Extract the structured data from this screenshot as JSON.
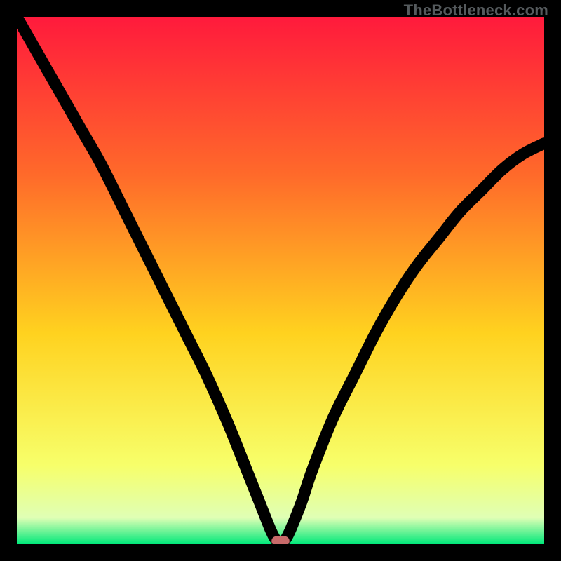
{
  "watermark": "TheBottleneck.com",
  "colors": {
    "gradient_stops": [
      "#ff1a3c",
      "#ff6a2a",
      "#ffd21f",
      "#f7ff6a",
      "#dfffb5",
      "#00e87a"
    ],
    "curve": "#000000",
    "marker": "#c86a6a",
    "frame": "#000000"
  },
  "chart_data": {
    "type": "line",
    "title": "",
    "xlabel": "",
    "ylabel": "",
    "xlim": [
      0,
      100
    ],
    "ylim": [
      0,
      100
    ],
    "grid": false,
    "legend": false,
    "x": [
      0,
      4,
      8,
      12,
      16,
      20,
      24,
      28,
      32,
      36,
      40,
      44,
      46,
      48,
      49,
      50,
      51,
      52,
      54,
      56,
      60,
      64,
      68,
      72,
      76,
      80,
      84,
      88,
      92,
      96,
      100
    ],
    "y": [
      100,
      93,
      86,
      79,
      72,
      64,
      56,
      48,
      40,
      32,
      23,
      13,
      8,
      3,
      1,
      0,
      1,
      3,
      8,
      14,
      24,
      32,
      40,
      47,
      53,
      58,
      63,
      67,
      71,
      74,
      76
    ],
    "marker": {
      "x": 50,
      "y": 0,
      "shape": "rounded-rect"
    },
    "notes": "Single black curve over red→green vertical gradient; values are unitless (no visible axes)."
  }
}
